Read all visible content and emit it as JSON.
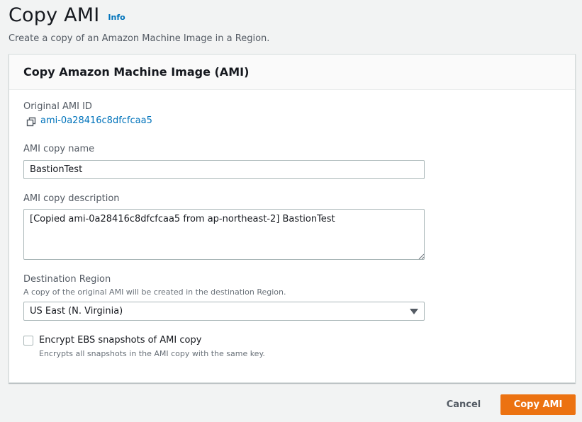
{
  "header": {
    "title": "Copy AMI",
    "info_label": "Info",
    "subtitle": "Create a copy of an Amazon Machine Image in a Region."
  },
  "panel": {
    "title": "Copy Amazon Machine Image (AMI)"
  },
  "form": {
    "original_ami": {
      "label": "Original AMI ID",
      "value": "ami-0a28416c8dfcfcaa5",
      "icon": "copy-icon"
    },
    "copy_name": {
      "label": "AMI copy name",
      "value": "BastionTest"
    },
    "copy_description": {
      "label": "AMI copy description",
      "value": "[Copied ami-0a28416c8dfcfcaa5 from ap-northeast-2] BastionTest"
    },
    "destination_region": {
      "label": "Destination Region",
      "description": "A copy of the original AMI will be created in the destination Region.",
      "selected": "US East (N. Virginia)"
    },
    "encrypt": {
      "label": "Encrypt EBS snapshots of AMI copy",
      "description": "Encrypts all snapshots in the AMI copy with the same key.",
      "checked": false
    }
  },
  "actions": {
    "cancel_label": "Cancel",
    "submit_label": "Copy AMI"
  },
  "colors": {
    "accent": "#ec7211",
    "link": "#0073bb",
    "background": "#f2f3f3"
  }
}
